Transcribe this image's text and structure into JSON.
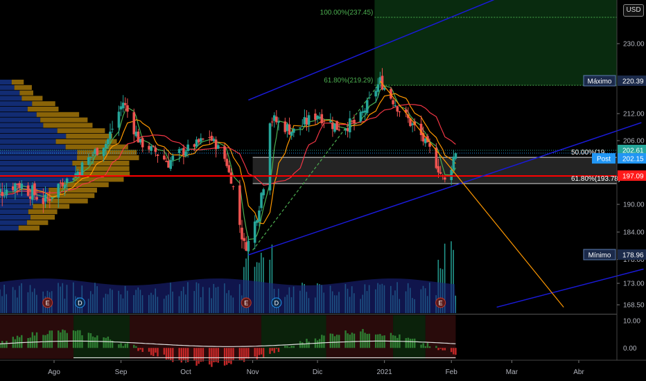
{
  "currency_button": "USD",
  "colors": {
    "background": "#000000",
    "up": "#26a69a",
    "down": "#ef5350",
    "trendline": "#1a1ad8",
    "fib_label": "#4caf50",
    "support": "#ff0000",
    "last_price_tag": "#26a69a",
    "post_tag": "#2196f3",
    "support_tag": "#ff1a1a",
    "extreme_tag": "#1b2a4a",
    "ma_fast": "#4caf50",
    "ma_mid": "#ff9800",
    "ma_slow": "#f23645",
    "volume": "#26a69a",
    "volume_area": "#1a237e",
    "profile_blue": "#2962ff",
    "profile_gold": "#b8860b",
    "downtrend": "#ff9800"
  },
  "chart_data": {
    "type": "candlestick",
    "x_axis_labels": [
      {
        "label": "Ago",
        "date": "2020-08-01"
      },
      {
        "label": "Sep",
        "date": "2020-09-01"
      },
      {
        "label": "Oct",
        "date": "2020-10-01"
      },
      {
        "label": "Nov",
        "date": "2020-11-01"
      },
      {
        "label": "Dic",
        "date": "2020-12-01"
      },
      {
        "label": "2021",
        "date": "2021-01-01"
      },
      {
        "label": "Feb",
        "date": "2021-02-01"
      },
      {
        "label": "Mar",
        "date": "2021-03-01"
      },
      {
        "label": "Abr",
        "date": "2021-04-01"
      }
    ],
    "y_axis_ticks": [
      "230.00",
      "212.00",
      "206.00",
      "196.00",
      "190.00",
      "184.00",
      "178.00",
      "173.00",
      "168.50"
    ],
    "ylim": [
      168,
      241
    ],
    "price_tags": [
      {
        "label": "Máximo",
        "value": "220.39",
        "y_value": 220.39,
        "kind": "extreme"
      },
      {
        "label": "",
        "value": "202.61",
        "y_value": 202.61,
        "kind": "last"
      },
      {
        "label": "Post",
        "value": "202.15",
        "y_value": 200.8,
        "kind": "post"
      },
      {
        "label": "",
        "value": "197.09",
        "y_value": 197.09,
        "kind": "support"
      },
      {
        "label": "Mínimo",
        "value": "178.96",
        "y_value": 178.96,
        "kind": "extreme"
      }
    ],
    "fib_labels": [
      {
        "text": "100.00%(237.45)",
        "y_value": 237.45
      },
      {
        "text": "61.80%(219.29)",
        "y_value": 219.29
      },
      {
        "text": "50.00%(19",
        "y_value": 201.1
      },
      {
        "text": "61.80%(193.78)",
        "y_value": 193.78
      }
    ],
    "event_markers": [
      {
        "letter": "E",
        "date": "2020-07-29"
      },
      {
        "letter": "D",
        "date": "2020-08-13"
      },
      {
        "letter": "E",
        "date": "2020-10-29"
      },
      {
        "letter": "D",
        "date": "2020-11-12"
      },
      {
        "letter": "E",
        "date": "2021-01-27"
      }
    ],
    "key_prices": {
      "start": "2020-07-01",
      "swing_high_sep": {
        "date": "2020-09-02",
        "value": 216.5
      },
      "low_oct": {
        "date": "2020-10-28",
        "value": 180.5
      },
      "low_nov": {
        "date": "2020-10-30",
        "value": 178.96
      },
      "gap_up": {
        "date": "2020-11-09",
        "value": 212.5
      },
      "high_jan": {
        "date": "2020-12-30",
        "value": 220.39
      },
      "low_feb": {
        "date": "2021-01-29",
        "value": 193.8
      },
      "last": {
        "date": "2021-02-03",
        "value": 202.61
      }
    },
    "oscillator": {
      "ticks": [
        "10.00",
        "0.00"
      ],
      "ylim": [
        -4,
        12
      ]
    },
    "legend": "none",
    "grid": false
  }
}
